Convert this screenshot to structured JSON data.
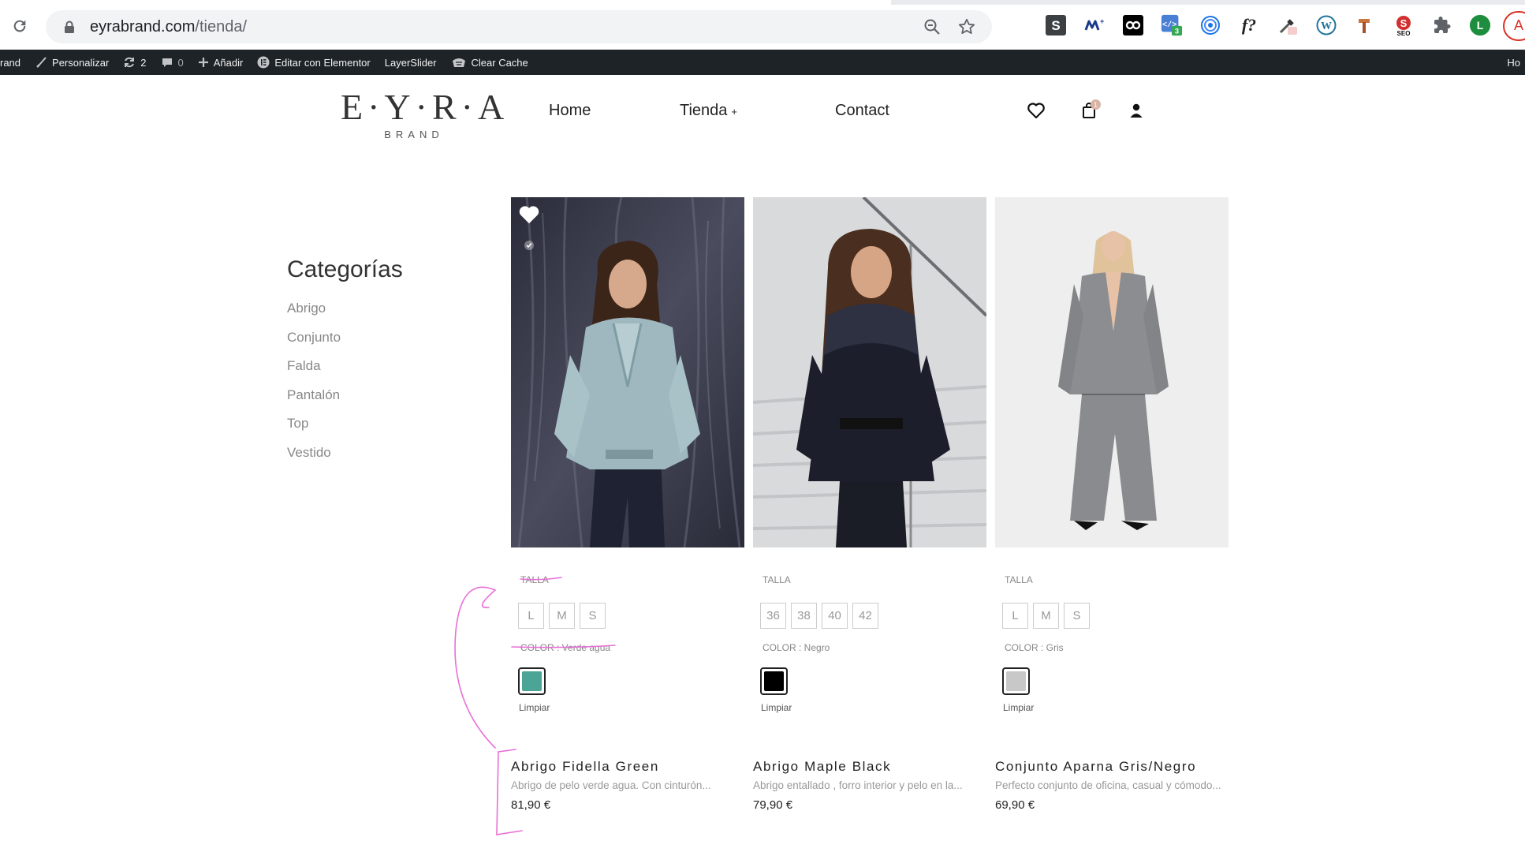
{
  "browser": {
    "url_host": "eyrabrand.com",
    "url_path": "/tienda/",
    "extensions": [
      {
        "name": "S",
        "color": "#3c4043",
        "bg": "#3c4043"
      },
      {
        "name": "M+",
        "color": "#1a73e8"
      },
      {
        "name": "oo",
        "color": "#000"
      },
      {
        "name": "code-badge",
        "badge": "3"
      },
      {
        "name": "f?",
        "color": "#222"
      }
    ],
    "profile_letter": "L"
  },
  "adminbar": {
    "site": "rand",
    "customize": "Personalizar",
    "updates": "2",
    "comments": "0",
    "add_new": "Añadir",
    "elementor": "Editar con Elementor",
    "layerslider": "LayerSlider",
    "clear_cache": "Clear Cache",
    "right_text": "Ho"
  },
  "header": {
    "logo_main": "E·Y·R·A",
    "logo_sub": "BRAND",
    "nav": [
      {
        "label": "Home"
      },
      {
        "label": "Tienda",
        "plus": "+"
      },
      {
        "label": "Contact"
      }
    ],
    "cart_count": "1"
  },
  "sidebar": {
    "title": "Categorías",
    "categories": [
      "Abrigo",
      "Conjunto",
      "Falda",
      "Pantalón",
      "Top",
      "Vestido"
    ]
  },
  "products": [
    {
      "size_label": "TALLA",
      "sizes": [
        "L",
        "M",
        "S"
      ],
      "color_label": "COLOR : Verde agua",
      "swatch": "#4aa597",
      "clear": "Limpiar",
      "name": "Abrigo Fidella Green",
      "desc": "Abrigo de pelo verde agua. Con cinturón...",
      "price": "81,90 €"
    },
    {
      "size_label": "TALLA",
      "sizes": [
        "36",
        "38",
        "40",
        "42"
      ],
      "color_label": "COLOR : Negro",
      "swatch": "#000000",
      "clear": "Limpiar",
      "name": "Abrigo Maple Black",
      "desc": "Abrigo entallado , forro interior y pelo en la...",
      "price": "79,90 €"
    },
    {
      "size_label": "TALLA",
      "sizes": [
        "L",
        "M",
        "S"
      ],
      "color_label": "COLOR : Gris",
      "swatch": "#c8c8c8",
      "clear": "Limpiar",
      "name": "Conjunto Aparna Gris/Negro",
      "desc": "Perfecto conjunto de oficina, casual y cómodo...",
      "price": "69,90 €"
    }
  ],
  "colors": {
    "annotation": "#e86fd8",
    "admin_bg": "#1d2327"
  }
}
